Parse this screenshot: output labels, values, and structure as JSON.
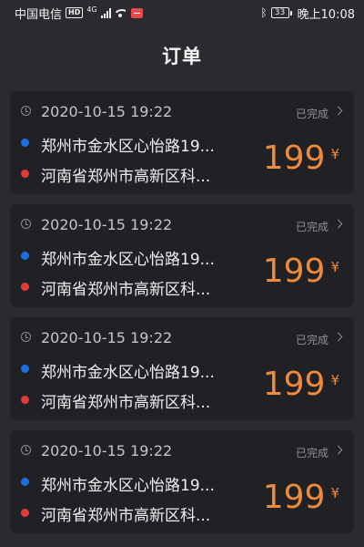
{
  "status_bar": {
    "carrier": "中国电信",
    "hd": "HD",
    "network": "4G",
    "battery": "33",
    "time": "晚上10:08"
  },
  "header": {
    "title": "订单"
  },
  "orders": [
    {
      "time": "2020-10-15 19:22",
      "status": "已完成",
      "from": "郑州市金水区心怡路19...",
      "to": "河南省郑州市高新区科...",
      "price": "199",
      "unit": "¥"
    },
    {
      "time": "2020-10-15 19:22",
      "status": "已完成",
      "from": "郑州市金水区心怡路19...",
      "to": "河南省郑州市高新区科...",
      "price": "199",
      "unit": "¥"
    },
    {
      "time": "2020-10-15 19:22",
      "status": "已完成",
      "from": "郑州市金水区心怡路19...",
      "to": "河南省郑州市高新区科...",
      "price": "199",
      "unit": "¥"
    },
    {
      "time": "2020-10-15 19:22",
      "status": "已完成",
      "from": "郑州市金水区心怡路19...",
      "to": "河南省郑州市高新区科...",
      "price": "199",
      "unit": "¥"
    }
  ],
  "colors": {
    "background": "#2a2b2f",
    "card": "#1f2125",
    "price": "#ee8a3a",
    "from_dot": "#1d6ee0",
    "to_dot": "#e53a3a"
  }
}
